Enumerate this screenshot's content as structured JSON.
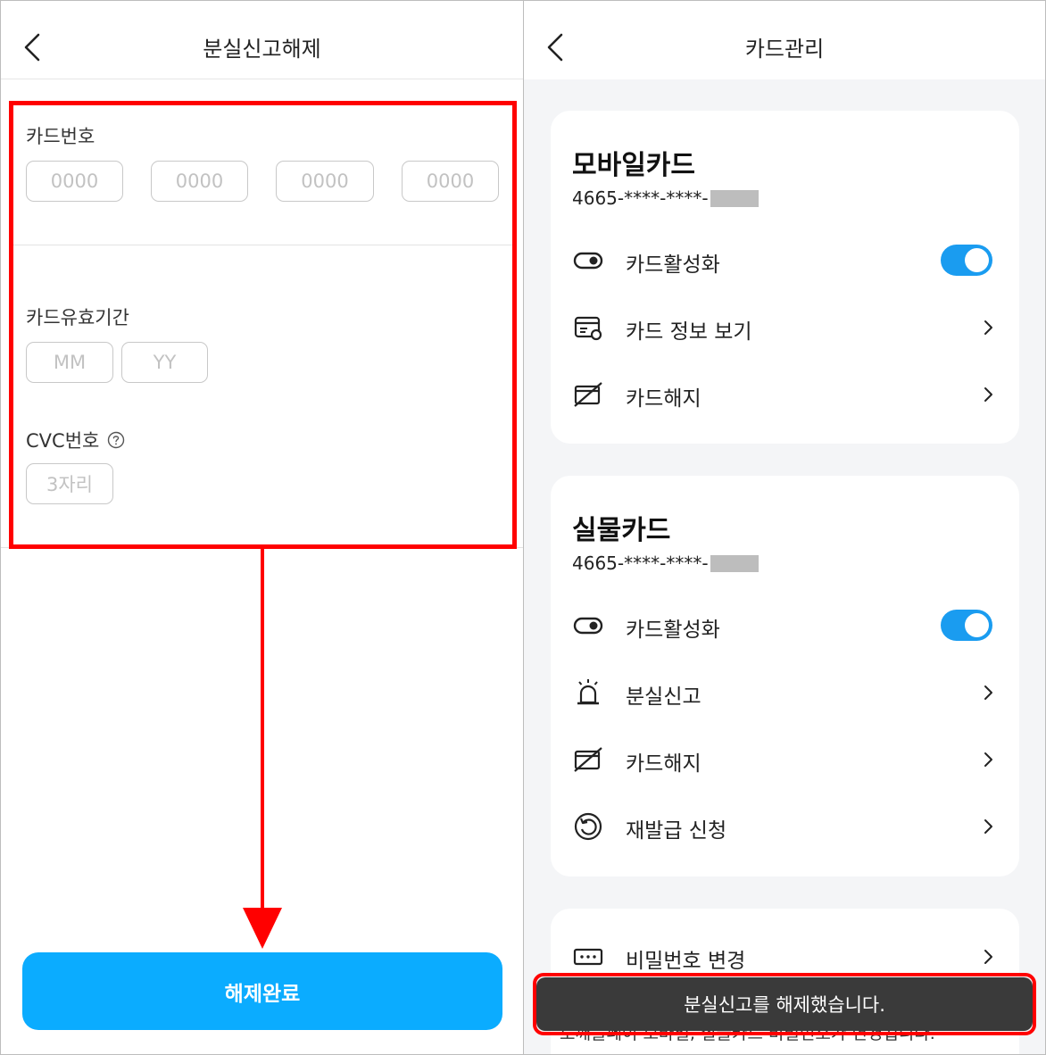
{
  "left": {
    "title": "분실신고해제",
    "card_number_label": "카드번호",
    "card_number_placeholders": [
      "0000",
      "0000",
      "0000",
      "0000"
    ],
    "expiry_label": "카드유효기간",
    "expiry_month_placeholder": "MM",
    "expiry_year_placeholder": "YY",
    "cvc_label": "CVC번호",
    "cvc_help_icon": "question-circle-icon",
    "cvc_placeholder": "3자리",
    "submit_label": "해제완료",
    "highlight_color": "#ff0000",
    "button_color": "#0bacff"
  },
  "right": {
    "title": "카드관리",
    "mobile_card": {
      "title": "모바일카드",
      "number_prefix": "4665-****-****-",
      "rows": [
        {
          "label": "카드활성화",
          "icon": "toggle-switch-icon",
          "control": "toggle",
          "on": true
        },
        {
          "label": "카드 정보 보기",
          "icon": "card-info-icon",
          "control": "chevron"
        },
        {
          "label": "카드해지",
          "icon": "card-cancel-icon",
          "control": "chevron"
        }
      ]
    },
    "physical_card": {
      "title": "실물카드",
      "number_prefix": "4665-****-****-",
      "rows": [
        {
          "label": "카드활성화",
          "icon": "toggle-switch-icon",
          "control": "toggle",
          "on": true
        },
        {
          "label": "분실신고",
          "icon": "siren-icon",
          "control": "chevron"
        },
        {
          "label": "카드해지",
          "icon": "card-cancel-icon",
          "control": "chevron"
        },
        {
          "label": "재발급 신청",
          "icon": "reissue-icon",
          "control": "chevron"
        }
      ]
    },
    "password_card": {
      "row_label": "비밀번호 변경",
      "row_icon": "password-icon",
      "behind_toast_text": "도깨블페이 모바일, 실물카드 비밀번호가 변경됩니다."
    },
    "toast_message": "분실신고를 해제했습니다.",
    "toggle_color": "#1a9cf0"
  }
}
